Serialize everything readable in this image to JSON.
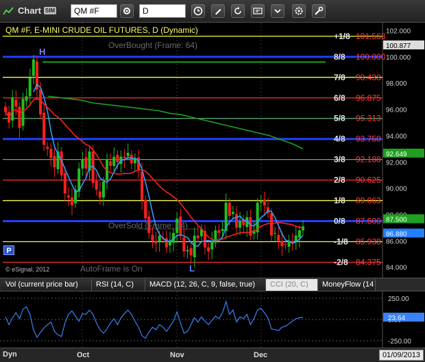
{
  "toolbar": {
    "title": "Chart",
    "sim_badge": "SIM",
    "symbol_value": "QM #F",
    "interval_value": "D",
    "icons": [
      "gear-icon",
      "clock-icon",
      "pencil-icon",
      "refresh-icon",
      "get-icon",
      "settings-icon",
      "wrench-icon"
    ]
  },
  "chart_title": "QM #F, E-MINI CRUDE OIL FUTURES, D (Dynamic)",
  "overbought_label": "OverBought (Frame: 64)",
  "oversold_label": "OverSold (Frame: 64)",
  "autoframe_label": "AutoFrame is On",
  "copyright": "© eSignal, 2012",
  "p_button": "P",
  "murrey_levels": [
    {
      "label": "+1/8",
      "value": "101.563",
      "price": 101.563,
      "color": "#ffff40"
    },
    {
      "label": "8/8",
      "value": "100.000",
      "price": 100.0,
      "color": "#2040ff"
    },
    {
      "label": "7/8",
      "value": "98.438",
      "price": 98.438,
      "color": "#ffff40"
    },
    {
      "label": "6/8",
      "value": "96.875",
      "price": 96.875,
      "color": "#ff3030"
    },
    {
      "label": "5/8",
      "value": "95.313",
      "price": 95.313,
      "color": "#60b080"
    },
    {
      "label": "4/8",
      "value": "93.750",
      "price": 93.75,
      "color": "#2040ff"
    },
    {
      "label": "3/8",
      "value": "92.188",
      "price": 92.188,
      "color": "#60b080"
    },
    {
      "label": "2/8",
      "value": "90.625",
      "price": 90.625,
      "color": "#ff3030"
    },
    {
      "label": "1/8",
      "value": "89.063",
      "price": 89.063,
      "color": "#ffff40"
    },
    {
      "label": "0/8",
      "value": "87.500",
      "price": 87.5,
      "color": "#2040ff"
    },
    {
      "label": "-1/8",
      "value": "85.938",
      "price": 85.938,
      "color": "#ffff40"
    },
    {
      "label": "-2/8",
      "value": "84.375",
      "price": 84.375,
      "color": "#ff3030"
    }
  ],
  "price_axis_ticks": [
    "102.000",
    "100.877",
    "100.000",
    "98.000",
    "96.000",
    "94.000",
    "92.000",
    "90.000",
    "88.000",
    "86.000",
    "84.000"
  ],
  "price_tags": [
    {
      "value": "100.877",
      "price": 100.877,
      "bg": "#dddddd",
      "fg": "#000000"
    },
    {
      "value": "92.649",
      "price": 92.649,
      "bg": "#20a020",
      "fg": "#ffffff"
    },
    {
      "value": "87.500",
      "price": 87.5,
      "bg": "#20a020",
      "fg": "#ffffff"
    },
    {
      "value": "86.880",
      "price": 86.88,
      "bg": "#2080ff",
      "fg": "#ffffff"
    }
  ],
  "pivot_labels": [
    {
      "text": "H",
      "color": "#8080ff"
    },
    {
      "text": "L",
      "color": "#6080ff"
    }
  ],
  "tabs": [
    {
      "label": "Vol (current price bar)",
      "active": false
    },
    {
      "label": "RSI (14, C)",
      "active": false
    },
    {
      "label": "MACD (12, 26, C, 9, false, true)",
      "active": false
    },
    {
      "label": "CCI (20, C)",
      "active": true
    },
    {
      "label": "MoneyFlow (14",
      "active": false
    }
  ],
  "cci_axis_ticks": [
    "250.00",
    "0.00",
    "-250.00"
  ],
  "cci_tag": "23.64",
  "x_axis_labels": [
    "Oct",
    "Nov",
    "Dec"
  ],
  "bottom": {
    "mode": "Dyn",
    "date": "01/09/2013"
  },
  "chart_data": {
    "type": "candlestick",
    "title": "QM #F, E-MINI CRUDE OIL FUTURES, D (Dynamic)",
    "ylim": [
      83.2,
      102.6
    ],
    "cci_ylim": [
      -330,
      330
    ],
    "series_colors": {
      "up": "#20c020",
      "down": "#ff2020",
      "ma_fast": "#30a0ff",
      "ma_mid": "#ff2020",
      "ma_slow": "#20a020",
      "cci": "#3b82f6"
    },
    "closes": [
      95.8,
      95.0,
      96.9,
      96.2,
      94.6,
      96.8,
      97.0,
      98.4,
      99.8,
      97.5,
      95.6,
      93.3,
      93.0,
      92.3,
      91.6,
      92.8,
      91.0,
      89.6,
      89.3,
      88.7,
      89.9,
      91.5,
      92.2,
      91.5,
      92.8,
      90.4,
      89.9,
      89.3,
      90.5,
      92.2,
      91.7,
      92.4,
      92.0,
      92.4,
      92.3,
      92.7,
      91.9,
      92.2,
      91.4,
      89.1,
      87.7,
      86.6,
      86.0,
      85.8,
      86.4,
      86.2,
      85.5,
      86.0,
      86.6,
      87.7,
      86.4,
      85.2,
      85.3,
      84.9,
      86.4,
      86.2,
      86.9,
      85.5,
      85.2,
      86.0,
      86.8,
      86.6,
      86.9,
      88.9,
      87.9,
      88.2,
      87.0,
      87.5,
      87.2,
      87.8,
      86.4,
      86.8,
      88.9,
      89.0,
      88.7,
      88.1,
      86.4,
      86.6,
      86.0,
      85.6,
      85.7,
      86.0,
      85.8,
      86.4,
      86.8,
      87.1
    ],
    "ma_slow": [
      97.0,
      96.9,
      96.8,
      96.7,
      96.5,
      96.4,
      96.3,
      96.2,
      96.1,
      96.0,
      95.9,
      95.7,
      95.6,
      95.4,
      95.2,
      95.0,
      94.8,
      94.6,
      94.4,
      94.2,
      94.0,
      93.7,
      93.4,
      93.0
    ],
    "cci": [
      30,
      -60,
      20,
      80,
      10,
      120,
      150,
      60,
      -120,
      -210,
      -150,
      -100,
      -60,
      -30,
      -140,
      -180,
      -200,
      -40,
      60,
      100,
      40,
      -20,
      70,
      60,
      110,
      60,
      -40,
      -120,
      -160,
      -110,
      -40,
      10,
      -60,
      20,
      70,
      110,
      60,
      -20,
      -90,
      -190,
      -220,
      -150,
      -90,
      -120,
      -60,
      -90,
      -140,
      -80,
      -20,
      90,
      -40,
      -160,
      -140,
      -60,
      20,
      -30,
      30,
      -20,
      -60,
      -10,
      40,
      10,
      80,
      210,
      60,
      110,
      -30,
      30,
      10,
      60,
      -60,
      10,
      110,
      130,
      80,
      20,
      -110,
      -120,
      -130,
      -90,
      -80,
      -50,
      -20,
      10,
      20,
      24
    ]
  }
}
